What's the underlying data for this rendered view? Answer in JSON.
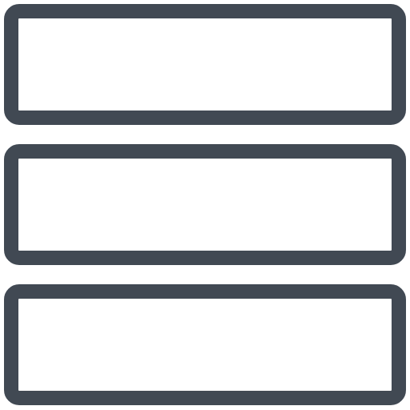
{
  "icon": {
    "name": "list-rows-icon",
    "stroke_color": "#414953",
    "fill_color": "#ffffff",
    "row_count": 3
  }
}
